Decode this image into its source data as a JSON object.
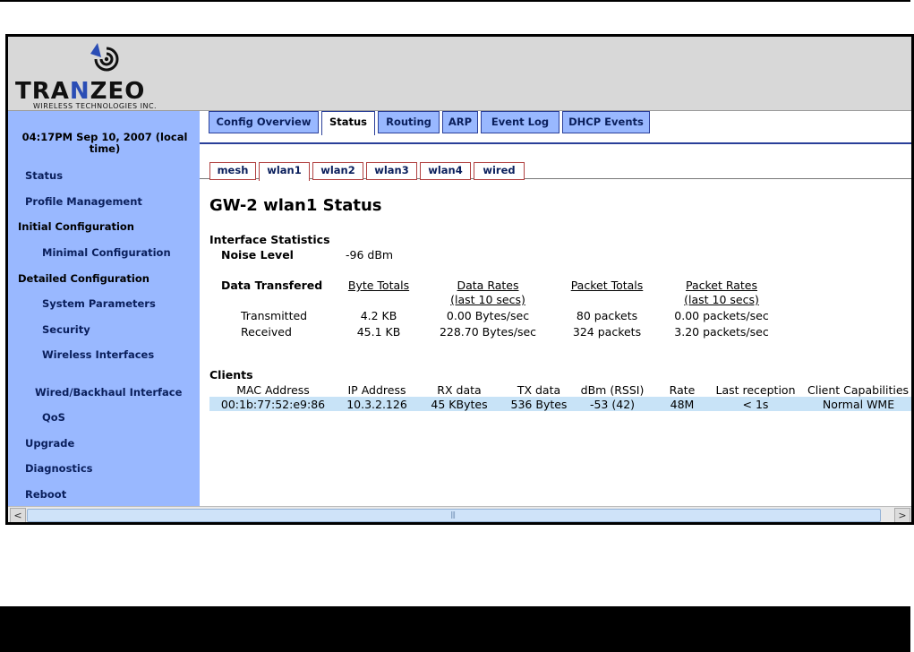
{
  "brand": {
    "name_pre": "TRA",
    "name_n": "N",
    "name_post": "ZEO",
    "tagline": "WIRELESS TECHNOLOGIES INC.",
    "logo_icon": "antenna-signal-icon",
    "accent_color": "#2a4db5"
  },
  "sidebar": {
    "time": "04:17PM Sep 10, 2007 (local time)",
    "items": [
      {
        "label": "Status"
      },
      {
        "label": "Profile Management"
      },
      {
        "label": "Initial Configuration"
      },
      {
        "label": "Minimal Configuration"
      },
      {
        "label": "Detailed Configuration"
      },
      {
        "label": "System Parameters"
      },
      {
        "label": "Security"
      },
      {
        "label": "Wireless Interfaces"
      },
      {
        "label": "Wired/Backhaul Interface"
      },
      {
        "label": "QoS"
      },
      {
        "label": "Upgrade"
      },
      {
        "label": "Diagnostics"
      },
      {
        "label": "Reboot"
      }
    ]
  },
  "tabs": [
    "Config Overview",
    "Status",
    "Routing",
    "ARP",
    "Event Log",
    "DHCP Events"
  ],
  "active_tab": "Status",
  "subtabs": [
    "mesh",
    "wlan1",
    "wlan2",
    "wlan3",
    "wlan4",
    "wired"
  ],
  "active_subtab": "wlan1",
  "page_title": "GW-2 wlan1 Status",
  "stats": {
    "heading": "Interface Statistics",
    "noise_label": "Noise Level",
    "noise_value": "-96 dBm",
    "data_label": "Data Transfered",
    "col_byte_totals": "Byte Totals",
    "col_data_rates": "Data Rates",
    "col_data_rates_sub": "(last 10 secs)",
    "col_packet_totals": "Packet Totals",
    "col_packet_rates": "Packet Rates",
    "col_packet_rates_sub": "(last 10 secs)",
    "rows": [
      {
        "label": "Transmitted",
        "bytes": "4.2 KB",
        "rate": "0.00 Bytes/sec",
        "packets": "80 packets",
        "prate": "0.00 packets/sec"
      },
      {
        "label": "Received",
        "bytes": "45.1 KB",
        "rate": "228.70 Bytes/sec",
        "packets": "324 packets",
        "prate": "3.20 packets/sec"
      }
    ]
  },
  "clients": {
    "heading": "Clients",
    "columns": [
      "MAC Address",
      "IP Address",
      "RX data",
      "TX data",
      "dBm (RSSI)",
      "Rate",
      "Last reception",
      "Client Capabilities"
    ],
    "rows": [
      [
        "00:1b:77:52:e9:86",
        "10.3.2.126",
        "45 KBytes",
        "536 Bytes",
        "-53 (42)",
        "48M",
        "< 1s",
        "Normal WME"
      ]
    ]
  },
  "scrollbar": {
    "left_arrow": "<",
    "right_arrow": ">",
    "grip": "|||"
  }
}
